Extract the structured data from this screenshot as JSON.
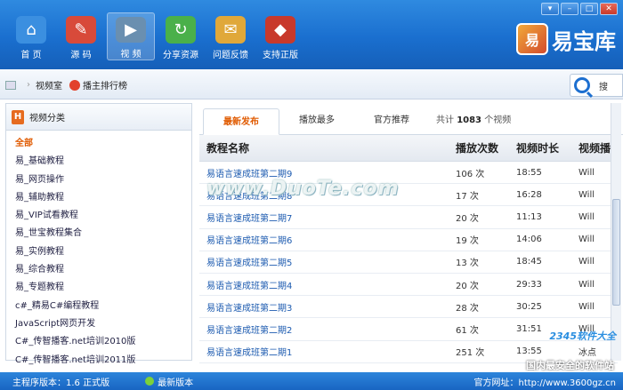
{
  "window": {
    "min": "▾",
    "restore": "–",
    "max": "□",
    "close": "✕"
  },
  "nav": [
    {
      "label": "首  页",
      "icon": "home-icon",
      "color": "#3b8fe0",
      "glyph": "⌂"
    },
    {
      "label": "源  码",
      "icon": "source-code-icon",
      "color": "#d84a3a",
      "glyph": "✎"
    },
    {
      "label": "视  频",
      "icon": "video-icon",
      "color": "#6a8fb0",
      "glyph": "▶"
    },
    {
      "label": "分享资源",
      "icon": "share-icon",
      "color": "#4ab04a",
      "glyph": "↻"
    },
    {
      "label": "问题反馈",
      "icon": "feedback-icon",
      "color": "#e0a83a",
      "glyph": "✉"
    },
    {
      "label": "支持正版",
      "icon": "shield-icon",
      "color": "#c8392b",
      "glyph": "◆"
    }
  ],
  "logo": {
    "mark": "易",
    "text": "易宝库"
  },
  "breadcrumb": {
    "current": "视频室",
    "rank": "播主排行榜"
  },
  "search": {
    "label": "搜"
  },
  "sidebar": {
    "title": "视频分类",
    "items": [
      "全部",
      "易_基础教程",
      "易_网页操作",
      "易_辅助教程",
      "易_VIP试看教程",
      "易_世宝教程集合",
      "易_实例教程",
      "易_综合教程",
      "易_专题教程",
      "c#_精易C#编程教程",
      "JavaScript网页开发",
      "C#_传智播客.net培训2010版",
      "C#_传智播客.net培训2011版"
    ]
  },
  "tabs": [
    "最新发布",
    "播放最多",
    "官方推荐"
  ],
  "total": {
    "prefix": "共计",
    "count": "1083",
    "suffix": "个视频"
  },
  "table": {
    "headers": [
      "教程名称",
      "播放次数",
      "视频时长",
      "视频播"
    ],
    "rows": [
      [
        "易语言速成班第二期9",
        "106 次",
        "18:55",
        "Will"
      ],
      [
        "易语言速成班第二期8",
        "17 次",
        "16:28",
        "Will"
      ],
      [
        "易语言速成班第二期7",
        "20 次",
        "11:13",
        "Will"
      ],
      [
        "易语言速成班第二期6",
        "19 次",
        "14:06",
        "Will"
      ],
      [
        "易语言速成班第二期5",
        "13 次",
        "18:45",
        "Will"
      ],
      [
        "易语言速成班第二期4",
        "20 次",
        "29:33",
        "Will"
      ],
      [
        "易语言速成班第二期3",
        "28 次",
        "30:25",
        "Will"
      ],
      [
        "易语言速成班第二期2",
        "61 次",
        "31:51",
        "Will"
      ],
      [
        "易语言速成班第二期1",
        "251 次",
        "13:55",
        "冰点"
      ]
    ]
  },
  "watermark": {
    "duote": "www.DuoTe.com",
    "site2345": "2345软件大全",
    "safe": "国内最安全的软件站"
  },
  "status": {
    "version": "主程序版本：1.6 正式版",
    "latest": "最新版本",
    "site": "官方网址：http://www.3600gz.cn"
  }
}
